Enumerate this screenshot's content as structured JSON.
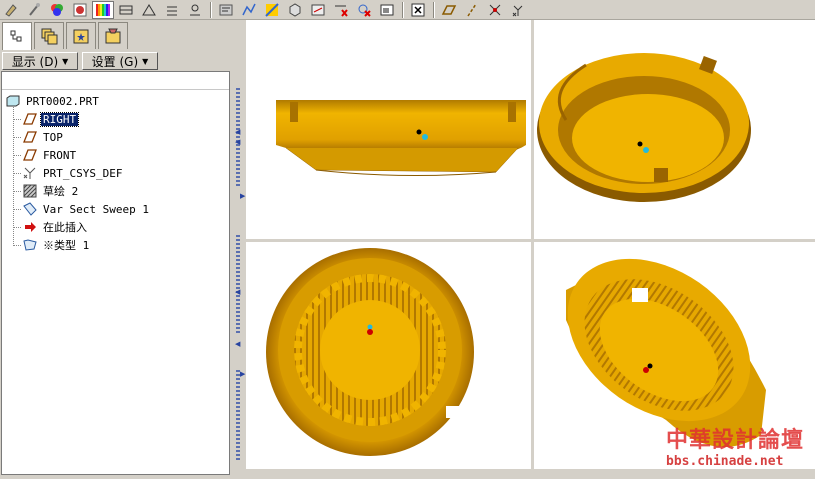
{
  "toolbar": {
    "icons": [
      "spin-icon",
      "sketch-icon",
      "appearance-icon",
      "appearance-gallery-icon",
      "color-bar-icon",
      "view-left-icon",
      "view-top-icon",
      "view-front-icon",
      "view-bottom-icon",
      "ribbon-icon",
      "analysis-icon",
      "render-icon",
      "model-display-icon",
      "dimension-icon",
      "erase-icon",
      "regenerate-icon",
      "close-window-icon",
      "datum-plane-display-icon",
      "datum-axis-display-icon",
      "datum-point-display-icon",
      "csys-display-icon"
    ]
  },
  "panel": {
    "tabs": [
      "model-tree-tab",
      "layer-tree-tab",
      "favorites-tab",
      "folder-browser-tab"
    ],
    "show_button": "显示 (D)",
    "settings_button": "设置 (G)"
  },
  "tree": {
    "root": "PRT0002.PRT",
    "items": [
      {
        "label": "RIGHT",
        "icon": "datum-plane-icon",
        "selected": true
      },
      {
        "label": "TOP",
        "icon": "datum-plane-icon",
        "selected": false
      },
      {
        "label": "FRONT",
        "icon": "datum-plane-icon",
        "selected": false
      },
      {
        "label": "PRT_CSYS_DEF",
        "icon": "csys-icon",
        "selected": false
      },
      {
        "label": "草绘 2",
        "icon": "sketch-feature-icon",
        "selected": false
      },
      {
        "label": "Var Sect Sweep 1",
        "icon": "sweep-icon",
        "selected": false
      },
      {
        "label": "在此插入",
        "icon": "insert-here-arrow-icon",
        "selected": false
      },
      {
        "label": "※类型 1",
        "icon": "pattern-icon",
        "selected": false
      }
    ]
  },
  "colors": {
    "model_gold": "#e7a800",
    "model_dark": "#a06a00",
    "selection_bg": "#0a246a"
  },
  "watermark": {
    "title": "中華設計論壇",
    "url": "bbs.chinade.net"
  }
}
